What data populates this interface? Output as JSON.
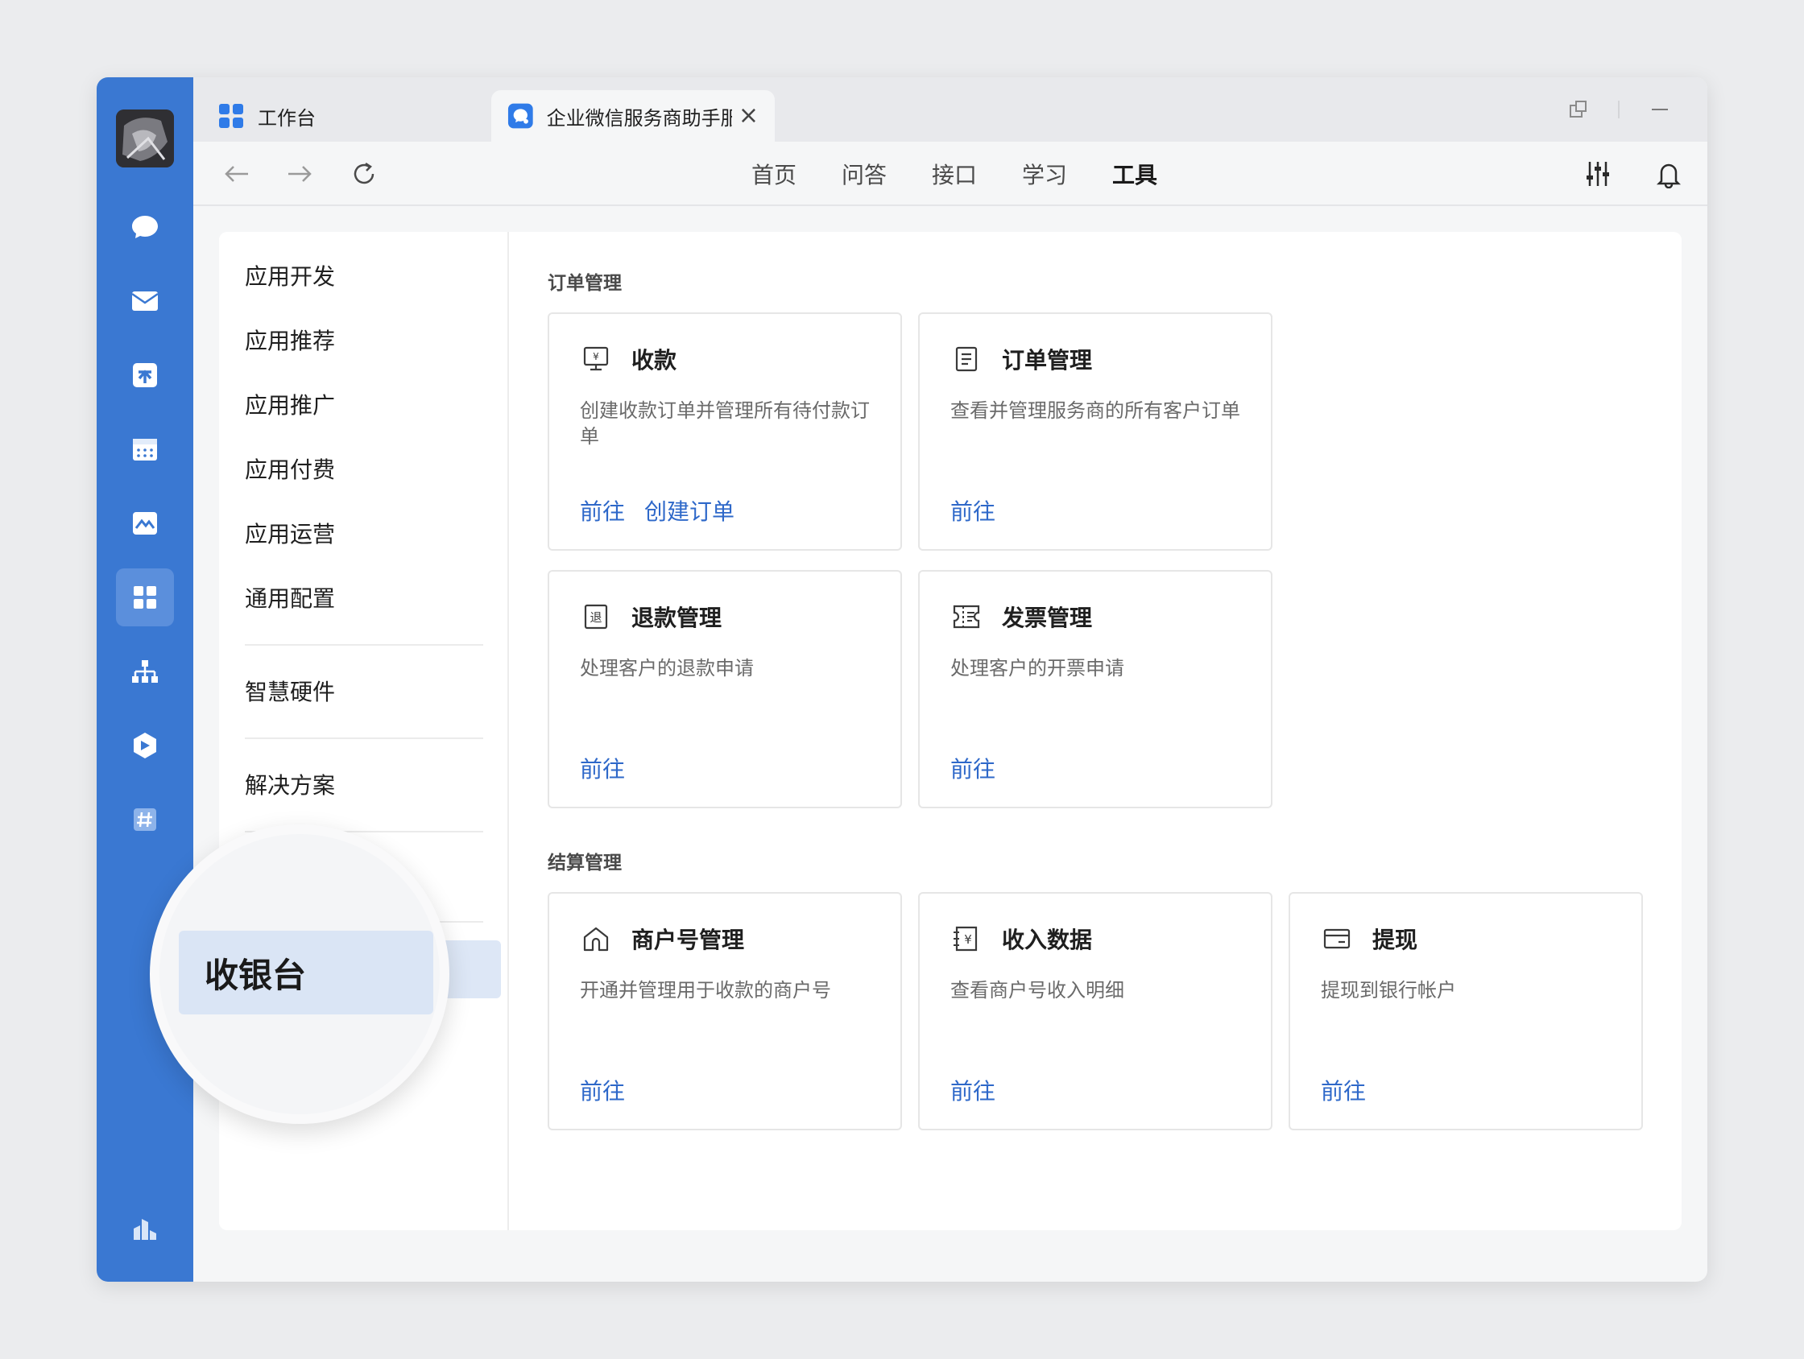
{
  "tabs": [
    {
      "label": "工作台"
    },
    {
      "label": "企业微信服务商助手服务"
    }
  ],
  "topnav": [
    "首页",
    "问答",
    "接口",
    "学习",
    "工具"
  ],
  "sidebar": {
    "items": [
      "应用开发",
      "应用推荐",
      "应用推广",
      "应用付费",
      "应用运营",
      "通用配置"
    ],
    "hardware": "智慧硬件",
    "solutions": "解决方案"
  },
  "magnifier_label": "收银台",
  "sections": [
    {
      "title": "订单管理"
    },
    {
      "title": "结算管理"
    }
  ],
  "cards": [
    {
      "icon": "cashier-icon",
      "title": "收款",
      "desc": "创建收款订单并管理所有待付款订单",
      "links": [
        "前往",
        "创建订单"
      ]
    },
    {
      "icon": "document-icon",
      "title": "订单管理",
      "desc": "查看并管理服务商的所有客户订单",
      "links": [
        "前往"
      ]
    },
    {
      "icon": "refund-icon",
      "title": "退款管理",
      "desc": "处理客户的退款申请",
      "links": [
        "前往"
      ]
    },
    {
      "icon": "invoice-icon",
      "title": "发票管理",
      "desc": "处理客户的开票申请",
      "links": [
        "前往"
      ]
    },
    {
      "icon": "store-icon",
      "title": "商户号管理",
      "desc": "开通并管理用于收款的商户号",
      "links": [
        "前往"
      ]
    },
    {
      "icon": "income-icon",
      "title": "收入数据",
      "desc": "查看商户号收入明细",
      "links": [
        "前往"
      ]
    },
    {
      "icon": "card-icon",
      "title": "提现",
      "desc": "提现到银行帐户",
      "links": [
        "前往"
      ]
    }
  ],
  "colors": {
    "rail": "#3a78d2",
    "link": "#2e68c9",
    "highlight": "#dde7f6"
  }
}
